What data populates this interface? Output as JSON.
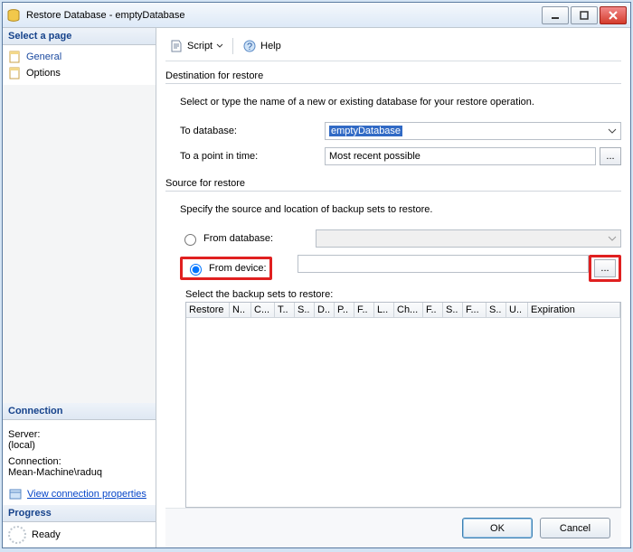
{
  "titlebar": {
    "title": "Restore Database - emptyDatabase"
  },
  "sidebar": {
    "select_page_header": "Select a page",
    "items": [
      {
        "label": "General"
      },
      {
        "label": "Options"
      }
    ],
    "connection_header": "Connection",
    "server_label": "Server:",
    "server_value": "(local)",
    "conn_label": "Connection:",
    "conn_value": "Mean-Machine\\raduq",
    "view_conn_props": "View connection properties",
    "progress_header": "Progress",
    "progress_value": "Ready"
  },
  "toolbar": {
    "script_label": "Script",
    "help_label": "Help"
  },
  "dest": {
    "section": "Destination for restore",
    "desc": "Select or type the name of a new or existing database for your restore operation.",
    "to_db_label": "To database:",
    "to_db_value": "emptyDatabase",
    "point_label": "To a point in time:",
    "point_value": "Most recent possible"
  },
  "source": {
    "section": "Source for restore",
    "desc": "Specify the source and location of backup sets to restore.",
    "from_db_label": "From database:",
    "from_device_label": "From device:",
    "from_device_value": ""
  },
  "grid": {
    "title": "Select the backup sets to restore:",
    "cols": [
      "Restore",
      "N..",
      "C...",
      "T..",
      "S..",
      "D..",
      "P..",
      "F..",
      "L..",
      "Ch...",
      "F..",
      "S..",
      "F...",
      "S..",
      "U..",
      "Expiration"
    ]
  },
  "footer": {
    "ok": "OK",
    "cancel": "Cancel"
  }
}
